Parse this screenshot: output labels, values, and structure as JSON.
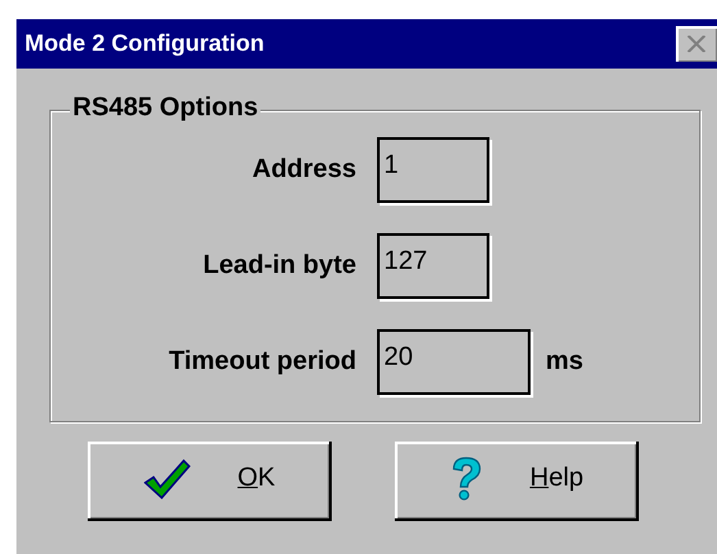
{
  "window": {
    "title": "Mode 2 Configuration",
    "close_disabled": true
  },
  "group": {
    "title": "RS485 Options",
    "fields": [
      {
        "label": "Address",
        "value": "1",
        "kind": "short"
      },
      {
        "label": "Lead-in byte",
        "value": "127",
        "kind": "short"
      },
      {
        "label": "Timeout period",
        "value": "20",
        "kind": "long",
        "unit": "ms"
      }
    ]
  },
  "buttons": [
    {
      "kind": "ok",
      "label": "OK"
    },
    {
      "kind": "help",
      "label": "Help"
    }
  ]
}
